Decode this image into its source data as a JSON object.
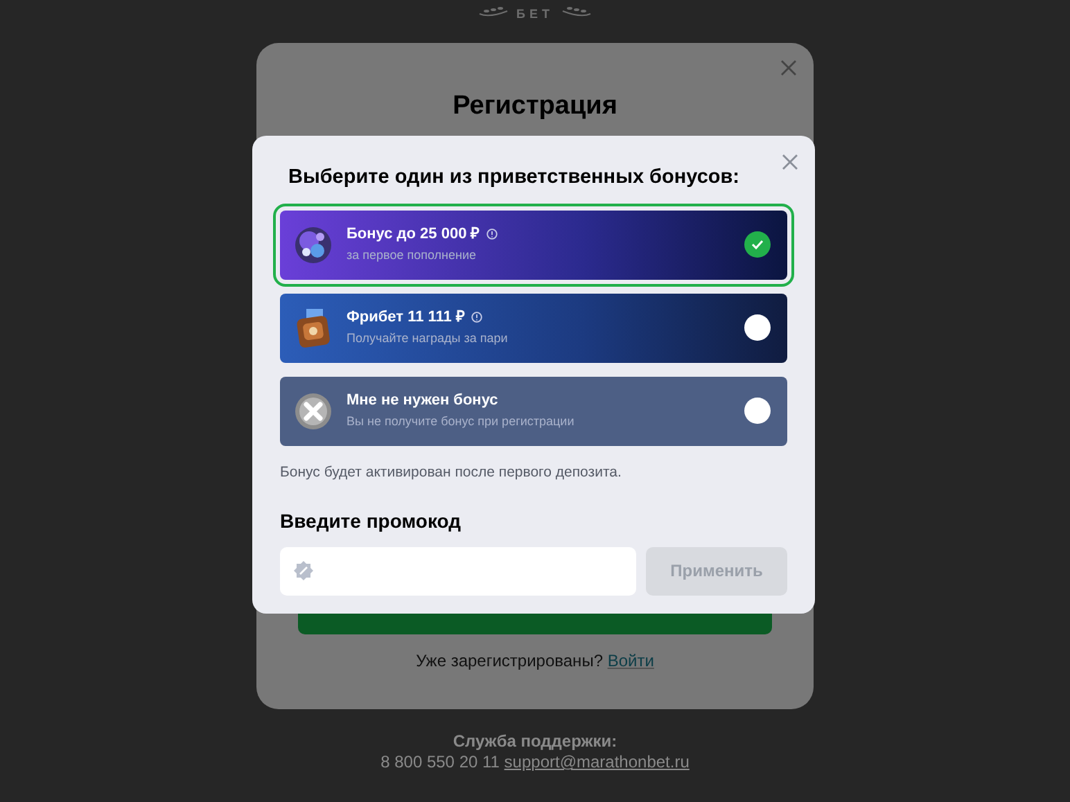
{
  "logo": {
    "text": "БЕТ"
  },
  "registration": {
    "title": "Регистрация",
    "login_prompt": "Уже зарегистрированы?",
    "login_link": "Войти"
  },
  "bonus_dialog": {
    "title": "Выберите один из приветственных бонусов:",
    "options": [
      {
        "kind": "bonus",
        "title": "Бонус до 25 000 ₽",
        "subtitle": "за первое пополнение",
        "info": true,
        "selected": true
      },
      {
        "kind": "freebet",
        "title": "Фрибет 11 111 ₽",
        "subtitle": "Получайте награды за пари",
        "info": true,
        "selected": false
      },
      {
        "kind": "none",
        "title": "Мне не нужен бонус",
        "subtitle": "Вы не получите бонус при регистрации",
        "info": false,
        "selected": false
      }
    ],
    "note": "Бонус будет активирован после первого депозита.",
    "promo_label": "Введите промокод",
    "apply_button": {
      "label": "Применить",
      "disabled": true
    }
  },
  "footer": {
    "support_label": "Служба поддержки:",
    "phone": "8 800 550 20 11",
    "email": "support@marathonbet.ru"
  }
}
